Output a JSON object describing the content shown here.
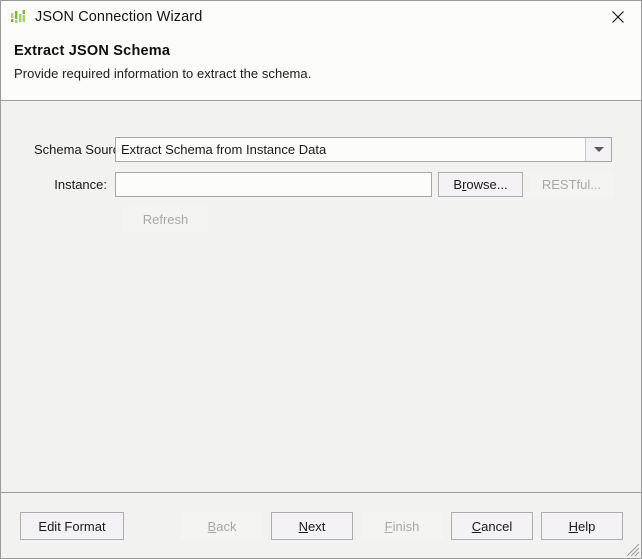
{
  "window": {
    "title": "JSON Connection Wizard",
    "icon": "json-bars-icon",
    "close_icon": "close-icon",
    "accent_color": "#7cc34a",
    "resize_grip": "resize-grip-icon"
  },
  "header": {
    "title": "Extract JSON Schema",
    "subtitle": "Provide required information to extract the schema."
  },
  "form": {
    "schema_source": {
      "label": "Schema Source:",
      "value": "Extract Schema from Instance Data",
      "dropdown_icon": "chevron-down-icon",
      "options": [
        "Extract Schema from Instance Data"
      ]
    },
    "instance": {
      "label": "Instance:",
      "value": "",
      "placeholder": ""
    },
    "browse_button": {
      "label": "Browse...",
      "mnemonic": "r",
      "enabled": true
    },
    "restful_button": {
      "label": "RESTful...",
      "enabled": false
    },
    "refresh_button": {
      "label": "Refresh",
      "enabled": false
    }
  },
  "footer": {
    "edit_format": {
      "label": "Edit Format",
      "enabled": true
    },
    "back": {
      "label": "Back",
      "mnemonic": "B",
      "enabled": false
    },
    "next": {
      "label": "Next",
      "mnemonic": "N",
      "enabled": true
    },
    "finish": {
      "label": "Finish",
      "mnemonic": "F",
      "enabled": false
    },
    "cancel": {
      "label": "Cancel",
      "mnemonic": "C",
      "enabled": true
    },
    "help": {
      "label": "Help",
      "mnemonic": "H",
      "enabled": true
    }
  }
}
